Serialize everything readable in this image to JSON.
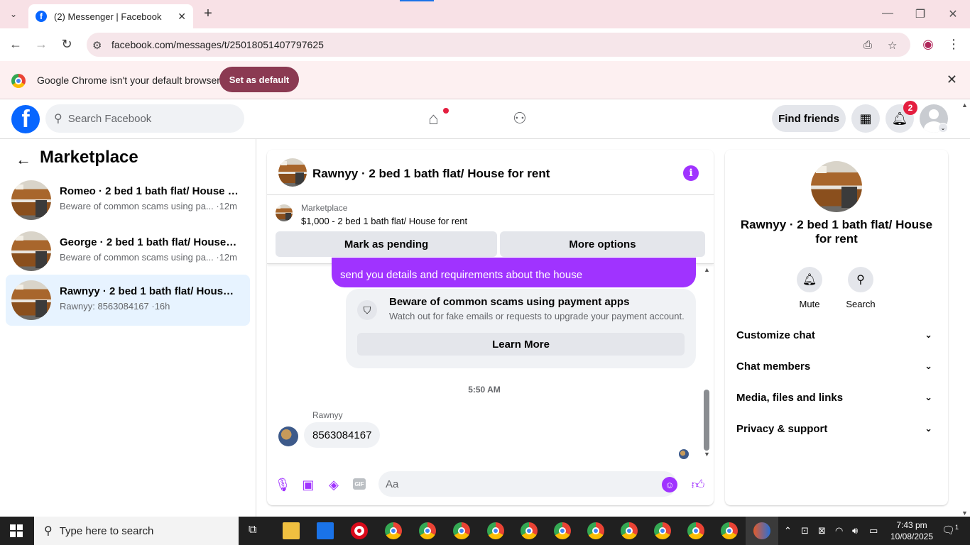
{
  "browser": {
    "tab_title": "(2) Messenger | Facebook",
    "url": "facebook.com/messages/t/25018051407797625",
    "infobar_message": "Google Chrome isn't your default browser",
    "set_default_label": "Set as default"
  },
  "fb": {
    "search_placeholder": "Search Facebook",
    "find_friends": "Find friends",
    "notification_count": "2"
  },
  "sidebar": {
    "title": "Marketplace",
    "conversations": [
      {
        "name": "Romeo · 2 bed 1 bath flat/ House f...",
        "preview": "Beware of common scams using pa... ·12m",
        "active": false
      },
      {
        "name": "George · 2 bed 1 bath flat/ House f...",
        "preview": "Beware of common scams using pa... ·12m",
        "active": false
      },
      {
        "name": "Rawnyy · 2 bed 1 bath flat/ House ...",
        "preview": "Rawnyy: 8563084167 ·16h",
        "active": true
      }
    ]
  },
  "chat": {
    "title": "Rawnyy · 2 bed 1 bath flat/ House for rent",
    "marketplace_label": "Marketplace",
    "listing": "$1,000 - 2 bed 1 bath flat/ House for rent",
    "mark_pending": "Mark as pending",
    "more_options": "More options",
    "outgoing_message": "send you details and requirements about the house",
    "scam_title": "Beware of common scams using payment apps",
    "scam_desc": "Watch out for fake emails or requests to upgrade your payment account.",
    "learn_more": "Learn More",
    "time": "5:50 AM",
    "sender": "Rawnyy",
    "incoming_message": "8563084167",
    "composer_placeholder": "Aa",
    "gif_label": "GIF"
  },
  "info_panel": {
    "name": "Rawnyy · 2 bed 1 bath flat/ House for rent",
    "mute": "Mute",
    "search": "Search",
    "sections": [
      "Customize chat",
      "Chat members",
      "Media, files and links",
      "Privacy & support"
    ]
  },
  "taskbar": {
    "search_placeholder": "Type here to search",
    "time": "7:43 pm",
    "date": "10/08/2025",
    "notification_count": "1"
  },
  "colors": {
    "messenger_accent": "#a033ff",
    "fb_blue": "#0866ff",
    "set_default_bg": "#8b3a52"
  }
}
